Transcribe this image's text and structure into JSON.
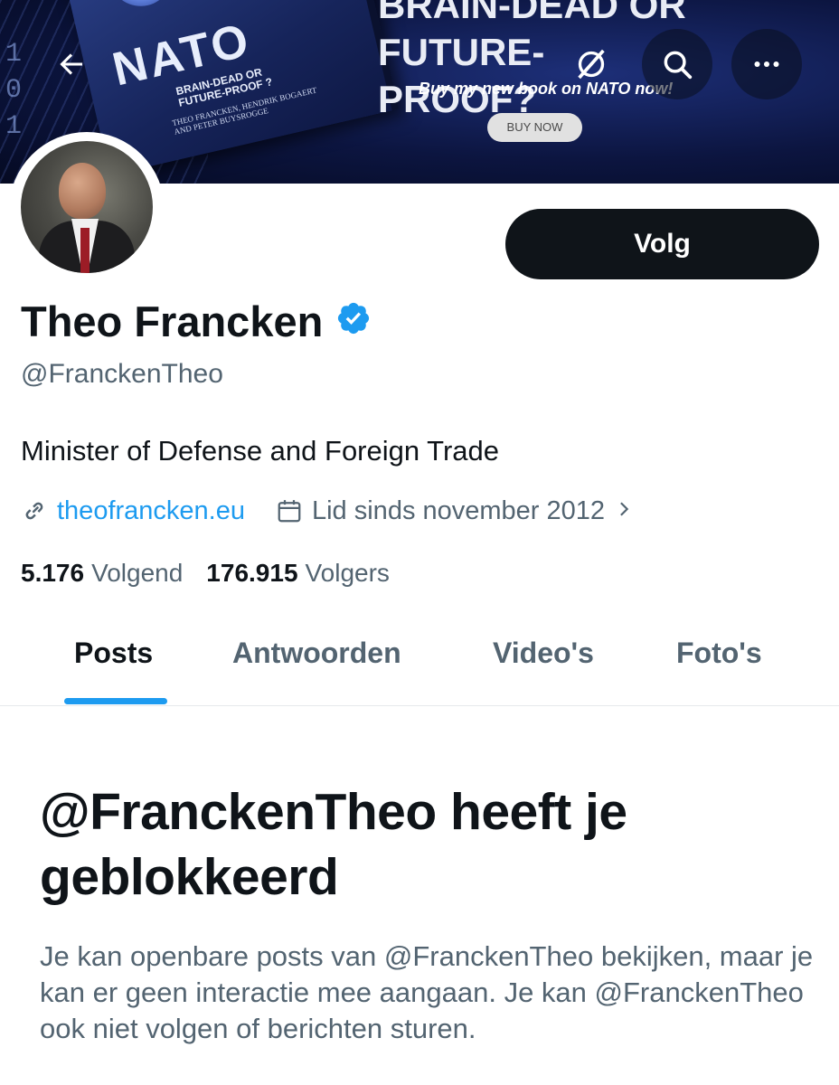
{
  "banner": {
    "book_title": "NATO",
    "book_subtitle": "BRAIN-DEAD OR FUTURE-PROOF ?",
    "book_authors": "THEO FRANCKEN, HENDRIK BOGAERT AND PETER BUYSROGGE",
    "headline": "BRAIN-DEAD OR FUTURE-PROOF?",
    "tagline": "Buy my new book on NATO now!",
    "buy_button": "BUY NOW"
  },
  "toolbar": {
    "back_icon": "arrow-left-icon",
    "grok_icon": "grok-icon",
    "search_icon": "search-icon",
    "more_icon": "more-horizontal-icon"
  },
  "profile": {
    "display_name": "Theo Francken",
    "handle": "@FranckenTheo",
    "bio": "Minister of Defense and Foreign Trade",
    "website": "theofrancken.eu",
    "joined": "Lid sinds november 2012",
    "following_count": "5.176",
    "following_label": "Volgend",
    "followers_count": "176.915",
    "followers_label": "Volgers",
    "follow_button": "Volg",
    "verified_color": "#1d9bf0"
  },
  "tabs": [
    {
      "label": "Posts",
      "active": true
    },
    {
      "label": "Antwoorden",
      "active": false
    },
    {
      "label": "Video's",
      "active": false
    },
    {
      "label": "Foto's",
      "active": false
    }
  ],
  "blocked": {
    "title": "@FranckenTheo heeft je geblokkeerd",
    "body": "Je kan openbare posts van @FranckenTheo bekijken, maar je kan er geen interactie mee aangaan. Je kan @FranckenTheo ook niet volgen of berichten sturen."
  },
  "colors": {
    "accent": "#1d9bf0",
    "text_primary": "#0f1419",
    "text_secondary": "#536471"
  }
}
